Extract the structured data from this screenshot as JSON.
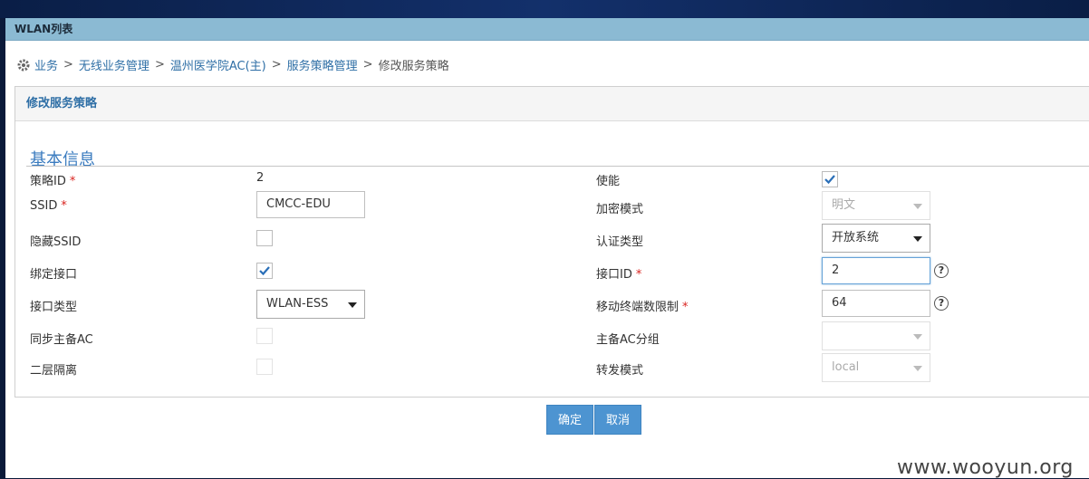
{
  "window": {
    "title": "WLAN列表"
  },
  "breadcrumb": {
    "items": [
      "业务",
      "无线业务管理",
      "温州医学院AC(主)",
      "服务策略管理"
    ],
    "current": "修改服务策略",
    "separator": ">"
  },
  "panel": {
    "title": "修改服务策略"
  },
  "section": {
    "title": "基本信息"
  },
  "form": {
    "policy_id": {
      "label": "策略ID",
      "required": "*",
      "value": "2"
    },
    "ssid": {
      "label": "SSID",
      "required": "*",
      "value": "CMCC-EDU"
    },
    "hide_ssid": {
      "label": "隐藏SSID",
      "checked": false
    },
    "bind_interface": {
      "label": "绑定接口",
      "checked": true
    },
    "interface_type": {
      "label": "接口类型",
      "value": "WLAN-ESS"
    },
    "sync_ac": {
      "label": "同步主备AC",
      "checked": false,
      "disabled": true
    },
    "l2_isolation": {
      "label": "二层隔离",
      "checked": false,
      "disabled": true
    },
    "enable": {
      "label": "使能",
      "checked": true
    },
    "encryption": {
      "label": "加密模式",
      "value": "明文",
      "disabled": true
    },
    "auth_type": {
      "label": "认证类型",
      "value": "开放系统"
    },
    "interface_id": {
      "label": "接口ID",
      "required": "*",
      "value": "2"
    },
    "max_terminals": {
      "label": "移动终端数限制",
      "required": "*",
      "value": "64"
    },
    "ac_group": {
      "label": "主备AC分组",
      "value": "",
      "disabled": true
    },
    "forward_mode": {
      "label": "转发模式",
      "value": "local",
      "disabled": true
    },
    "help_glyph": "?"
  },
  "buttons": {
    "confirm": "确定",
    "cancel": "取消"
  },
  "watermark": "www.wooyun.org",
  "colors": {
    "link": "#2f6fa6",
    "section": "#3a7bbf",
    "button": "#4d94d1",
    "required": "#d9231f",
    "titlebar": "#8bbad3"
  },
  "icons": {
    "breadcrumb": "gear-icon",
    "checkbox": "checkmark-icon",
    "select": "caret-down-icon",
    "help": "question-circle-icon"
  }
}
